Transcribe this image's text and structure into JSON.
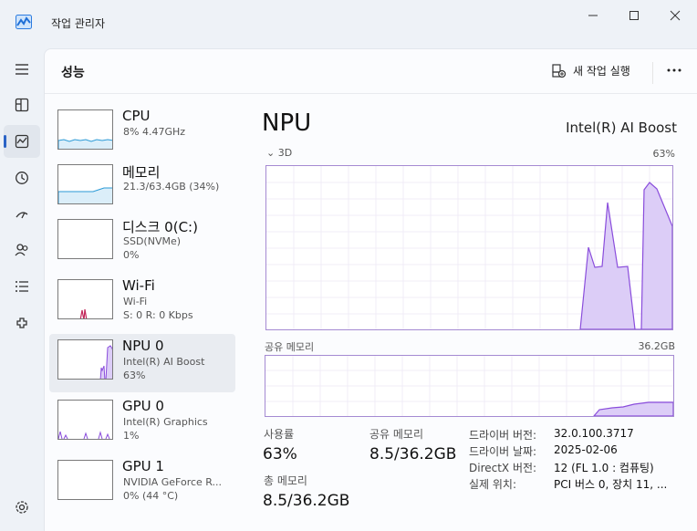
{
  "window": {
    "title": "작업 관리자"
  },
  "header": {
    "page_title": "성능",
    "new_task_label": "새 작업 실행"
  },
  "nav": {
    "items": [
      {
        "name": "hamburger-icon"
      },
      {
        "name": "processes-icon"
      },
      {
        "name": "performance-icon",
        "active": true
      },
      {
        "name": "app-history-icon"
      },
      {
        "name": "startup-icon"
      },
      {
        "name": "users-icon"
      },
      {
        "name": "details-icon"
      },
      {
        "name": "services-icon"
      },
      {
        "name": "settings-icon"
      }
    ]
  },
  "devices": [
    {
      "name": "CPU",
      "sub1": "8% 4.47GHz",
      "sub2": ""
    },
    {
      "name": "메모리",
      "sub1": "21.3/63.4GB (34%)",
      "sub2": ""
    },
    {
      "name": "디스크 0(C:)",
      "sub1": "SSD(NVMe)",
      "sub2": "0%"
    },
    {
      "name": "Wi-Fi",
      "sub1": "Wi-Fi",
      "sub2": "S: 0 R: 0 Kbps"
    },
    {
      "name": "NPU 0",
      "sub1": "Intel(R) AI Boost",
      "sub2": "63%"
    },
    {
      "name": "GPU 0",
      "sub1": "Intel(R) Graphics",
      "sub2": "1%"
    },
    {
      "name": "GPU 1",
      "sub1": "NVIDIA GeForce R...",
      "sub2": "0% (44 °C)"
    }
  ],
  "detail": {
    "title": "NPU",
    "model": "Intel(R) AI Boost",
    "engine_label": "3D",
    "engine_max": "63%",
    "shared_label": "공유 메모리",
    "shared_max": "36.2GB",
    "stats": {
      "util_label": "사용률",
      "util_value": "63%",
      "shared_label": "공유 메모리",
      "shared_value": "8.5/36.2GB",
      "total_label": "총 메모리",
      "total_value": "8.5/36.2GB"
    },
    "info": [
      {
        "k": "드라이버 버전:",
        "v": "32.0.100.3717"
      },
      {
        "k": "드라이버 날짜:",
        "v": "2025-02-06"
      },
      {
        "k": "DirectX 버전:",
        "v": "12 (FL 1.0 : 컴퓨팅)"
      },
      {
        "k": "실제 위치:",
        "v": "PCI 버스 0, 장치 11, ..."
      }
    ]
  },
  "colors": {
    "accent": "#2b64c6",
    "npu_line": "#8a4ddc",
    "npu_fill": "#dccdf7",
    "cpu_line": "#2b9ad6",
    "gpu_line": "#8a4ddc",
    "wifi_line": "#c2285a"
  }
}
